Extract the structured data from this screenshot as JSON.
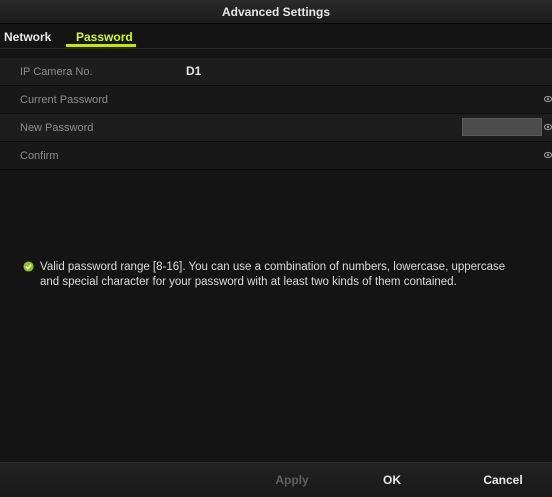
{
  "window": {
    "title": "Advanced Settings"
  },
  "tabs": [
    {
      "label": "Network",
      "active": false
    },
    {
      "label": "Password",
      "active": true
    }
  ],
  "fields": {
    "camera_no": {
      "label": "IP Camera No.",
      "value": "D1"
    },
    "current_password": {
      "label": "Current Password",
      "value": ""
    },
    "new_password": {
      "label": "New Password",
      "value": ""
    },
    "confirm": {
      "label": "Confirm",
      "value": ""
    }
  },
  "info": {
    "icon": "check-circle-icon",
    "text": "Valid password range [8-16]. You can use a combination of numbers, lowercase, uppercase and special character for your password with at least two kinds of them contained."
  },
  "footer": {
    "apply_label": "Apply",
    "ok_label": "OK",
    "cancel_label": "Cancel"
  },
  "colors": {
    "active_tab": "#d6ff00",
    "background": "#141414",
    "disabled_text": "#5f5f5f",
    "check_icon": "#9acd32"
  }
}
